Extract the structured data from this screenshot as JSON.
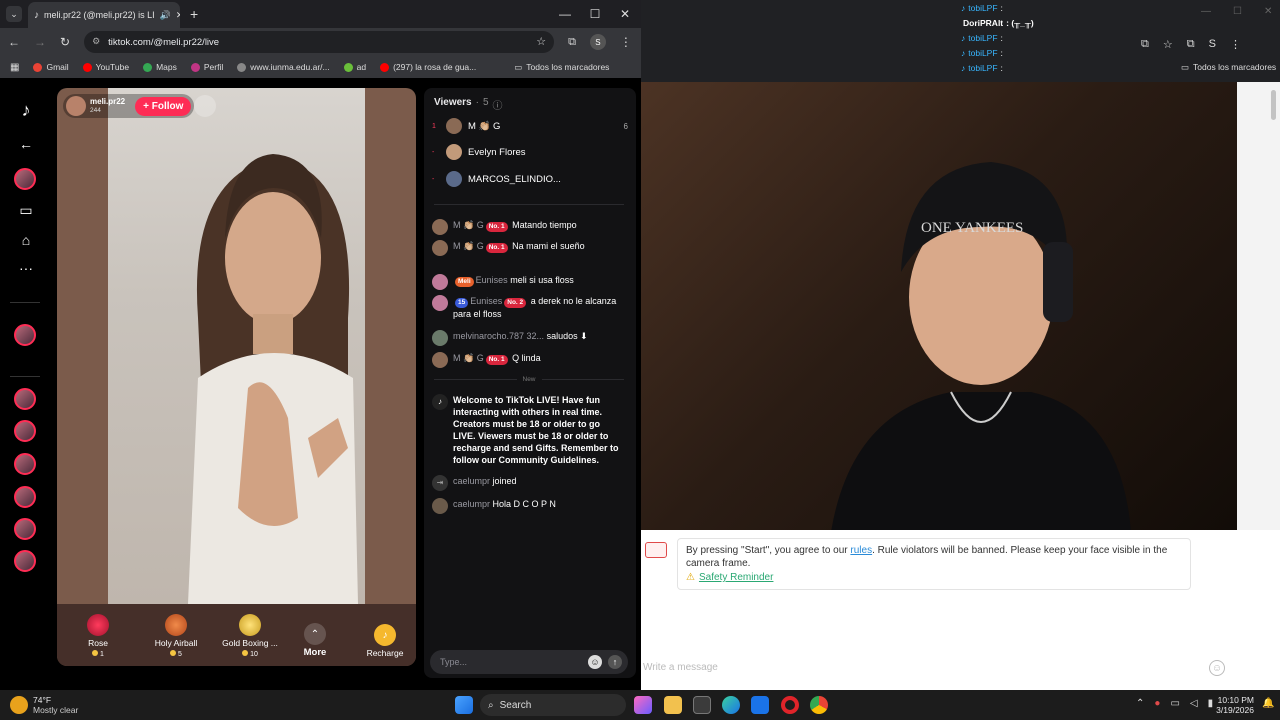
{
  "browser_left": {
    "tab_title": "meli.pr22 (@meli.pr22) is LI",
    "url": "tiktok.com/@meli.pr22/live",
    "bookmarks": [
      "Gmail",
      "YouTube",
      "Maps",
      "Perfil",
      "www.iunma.edu.ar/...",
      "ad",
      "(297) la rosa de gua..."
    ],
    "all_bookmarks": "Todos los marcadores"
  },
  "live": {
    "host_name": "meli.pr22",
    "host_likes": "244",
    "follow_label": "+ Follow",
    "gifts": [
      {
        "name": "Rose",
        "price": "1"
      },
      {
        "name": "Holy Airball",
        "price": "5"
      },
      {
        "name": "Gold Boxing ...",
        "price": "10"
      }
    ],
    "more_label": "More",
    "recharge_label": "Recharge",
    "viewers_label": "Viewers",
    "viewers_count": "5",
    "viewers": [
      {
        "rank": "1",
        "name": "M 👏🏼 G",
        "score": "6"
      },
      {
        "rank": "-",
        "name": "Evelyn Flores",
        "score": ""
      },
      {
        "rank": "-",
        "name": "MARCOS_ELINDIO...",
        "score": ""
      }
    ],
    "messages": [
      {
        "name": "M 👏🏼 G",
        "badge": "No. 1",
        "text": "Matando tiempo"
      },
      {
        "name": "M 👏🏼 G",
        "badge": "No. 1",
        "text": "Na mami el sueño"
      },
      {
        "name": "Eunises",
        "badge": "Meli",
        "text": "meli si usa floss"
      },
      {
        "name": "Eunises",
        "badge": "No. 2",
        "text": "a derek no le alcanza para el floss"
      },
      {
        "name": "melvinarocho.787 32...",
        "badge": "",
        "text": "saludos ⬇"
      },
      {
        "name": "M 👏🏼 G",
        "badge": "No. 1",
        "text": "Q linda"
      }
    ],
    "new_label": "New",
    "welcome": "Welcome to TikTok LIVE! Have fun interacting with others in real time. Creators must be 18 or older to go LIVE. Viewers must be 18 or older to recharge and send Gifts. Remember to follow our Community Guidelines.",
    "join": {
      "name": "caelumpr",
      "text": "joined"
    },
    "last": {
      "name": "caelumpr",
      "text": "Hola D C O P N"
    },
    "type_placeholder": "Type..."
  },
  "right": {
    "overlay": [
      {
        "name": "tobiLPF",
        "text": ":"
      },
      {
        "name": "DoriPRAlt",
        "text": ": (╥_╥)"
      },
      {
        "name": "tobiLPF",
        "text": ":"
      },
      {
        "name": "tobiLPF",
        "text": ":"
      },
      {
        "name": "tobiLPF",
        "text": ":"
      }
    ],
    "all_bookmarks": "Todos los marcadores",
    "notice_pre": "By pressing \"Start\", you agree to our ",
    "notice_link": "rules",
    "notice_post": ". Rule violators will be banned. Please keep your face visible in the camera frame.",
    "safety": "Safety Reminder",
    "message_placeholder": "Write a message"
  },
  "taskbar": {
    "weather_temp": "74°F",
    "weather_desc": "Mostly clear",
    "search": "Search",
    "time": "10:10 PM",
    "date": "3/19/2026"
  }
}
